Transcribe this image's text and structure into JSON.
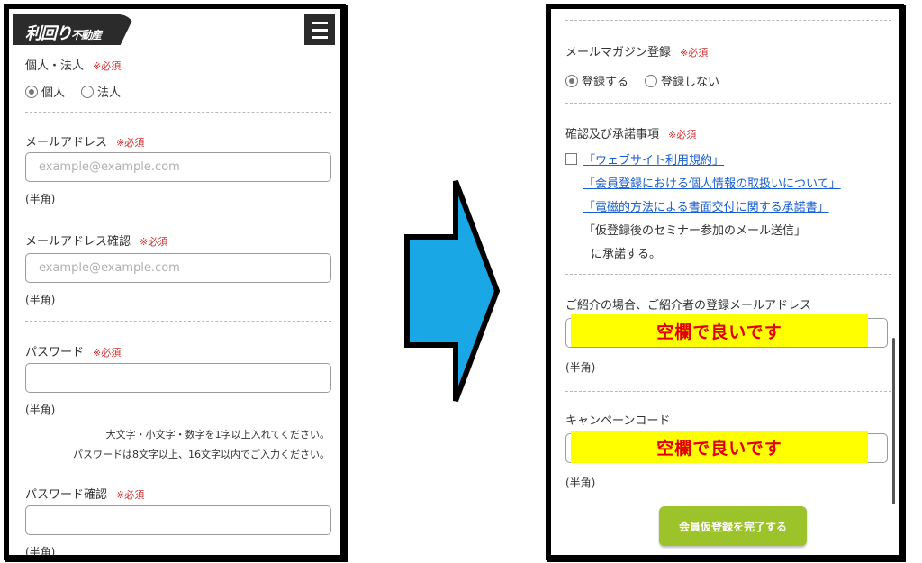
{
  "left_screen": {
    "logo": {
      "main": "利回り",
      "sub": "不動産"
    },
    "menu_icon": "hamburger-menu-icon",
    "type_field": {
      "label": "個人・法人",
      "required": "※必須",
      "options": [
        "個人",
        "法人"
      ],
      "selected": "個人"
    },
    "email": {
      "label": "メールアドレス",
      "required": "※必須",
      "placeholder": "example@example.com",
      "hint": "(半角)"
    },
    "email_confirm": {
      "label": "メールアドレス確認",
      "required": "※必須",
      "placeholder": "example@example.com",
      "hint": "(半角)"
    },
    "password": {
      "label": "パスワード",
      "required": "※必須",
      "hint": "(半角)",
      "note_1": "大文字・小文字・数字を1字以上入れてください。",
      "note_2": "パスワードは8文字以上、16文字以内でご入力ください。"
    },
    "password_confirm": {
      "label": "パスワード確認",
      "required": "※必須",
      "hint": "(半角)"
    }
  },
  "right_screen": {
    "magazine": {
      "label": "メールマガジン登録",
      "required": "※必須",
      "options": [
        "登録する",
        "登録しない"
      ],
      "selected": "登録する"
    },
    "consent": {
      "label": "確認及び承諾事項",
      "required": "※必須",
      "links": [
        "「ウェブサイト利用規約」",
        "「会員登録における個人情報の取扱いについて」",
        "「電磁的方法による書面交付に関する承諾書」"
      ],
      "text_1": "「仮登録後のセミナー参加のメール送信」",
      "text_2": "に承諾する。"
    },
    "referrer": {
      "label": "ご紹介の場合、ご紹介者の登録メールアドレス",
      "hint": "(半角)",
      "overlay": "空欄で良いです"
    },
    "campaign": {
      "label": "キャンペーンコード",
      "hint": "(半角)",
      "overlay": "空欄で良いです"
    },
    "submit_label": "会員仮登録を完了する"
  },
  "colors": {
    "required": "#d23030",
    "link": "#1a5fd0",
    "highlight": "#ffff00",
    "highlight_text": "#e00000",
    "submit": "#9cc32a",
    "arrow": "#1aa7e6"
  },
  "arrow_icon": "right-arrow-icon"
}
